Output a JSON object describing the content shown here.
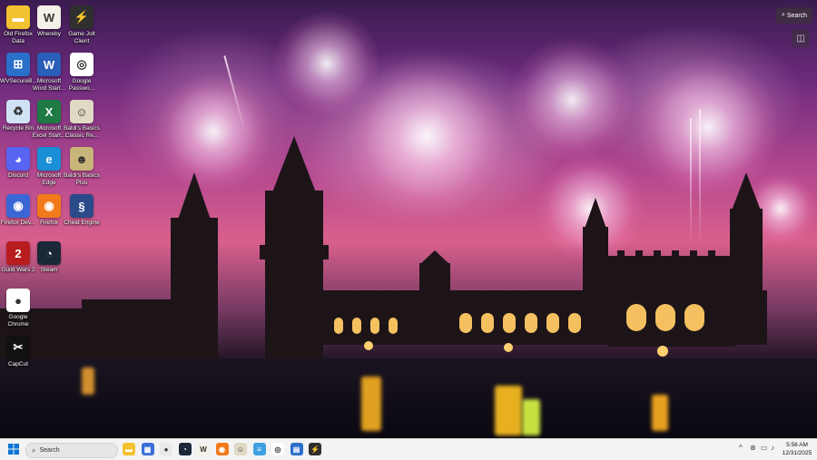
{
  "desktop": {
    "icons": [
      {
        "label": "Old Firefox Data",
        "icon": "folder-icon",
        "color": "#f2c230",
        "glyph": "▬"
      },
      {
        "label": "Whereby",
        "icon": "whereby-icon",
        "color": "#f5f0e8",
        "glyph": "W"
      },
      {
        "label": "Game Jolt Client",
        "icon": "game-jolt-icon",
        "color": "#2f2f2f",
        "glyph": "⚡"
      },
      {
        "label": "WVSecureB...",
        "icon": "wvsecure-icon",
        "color": "#2a6fc9",
        "glyph": "⊞"
      },
      {
        "label": "Microsoft Word Start...",
        "icon": "word-icon",
        "color": "#2b5eb8",
        "glyph": "W"
      },
      {
        "label": "Google Passwo...",
        "icon": "google-passwords-icon",
        "color": "#ffffff",
        "glyph": "◎"
      },
      {
        "label": "Recycle Bin",
        "icon": "recycle-bin-icon",
        "color": "#cfe3f5",
        "glyph": "♻"
      },
      {
        "label": "Microsoft Excel Start...",
        "icon": "excel-icon",
        "color": "#1f7a45",
        "glyph": "X"
      },
      {
        "label": "Baldi's Basics Classic Re...",
        "icon": "baldi-icon",
        "color": "#e0d9c4",
        "glyph": "☺"
      },
      {
        "label": "Discord",
        "icon": "discord-icon",
        "color": "#5865f2",
        "glyph": "◕"
      },
      {
        "label": "Microsoft Edge",
        "icon": "edge-icon",
        "color": "#1a8fd8",
        "glyph": "e"
      },
      {
        "label": "Baldi's Basics Plus",
        "icon": "baldi-plus-icon",
        "color": "#c9b47a",
        "glyph": "☻"
      },
      {
        "label": "Firefox Dev...",
        "icon": "firefox-dev-icon",
        "color": "#3b67d6",
        "glyph": "◉"
      },
      {
        "label": "Firefox",
        "icon": "firefox-icon",
        "color": "#f27a1a",
        "glyph": "◉"
      },
      {
        "label": "Cheat Engine",
        "icon": "cheat-engine-icon",
        "color": "#2a4a8a",
        "glyph": "§"
      },
      {
        "label": "Guild Wars 2",
        "icon": "guild-wars-icon",
        "color": "#b81d1d",
        "glyph": "2"
      },
      {
        "label": "Steam",
        "icon": "steam-icon",
        "color": "#1b2838",
        "glyph": "◔"
      },
      {
        "label": "Google Chrome",
        "icon": "chrome-icon",
        "color": "#ffffff",
        "glyph": "●"
      },
      {
        "label": "CapCut",
        "icon": "capcut-icon",
        "color": "#111111",
        "glyph": "✂"
      }
    ],
    "search_widget": {
      "label": "Search",
      "icon": "search-icon"
    },
    "corner_widget": {
      "icon": "camera-icon",
      "glyph": "◫"
    }
  },
  "taskbar": {
    "start": {
      "icon": "windows-start-icon"
    },
    "search": {
      "placeholder": "Search",
      "icon": "search-icon"
    },
    "pinned": [
      {
        "name": "file-explorer-icon",
        "color": "#f2c230",
        "glyph": "▬"
      },
      {
        "name": "ms-store-icon",
        "color": "#3b6fd8",
        "glyph": "▦"
      },
      {
        "name": "chrome-icon",
        "color": "#e9e9e9",
        "glyph": "●"
      },
      {
        "name": "steam-icon",
        "color": "#1b2838",
        "glyph": "◔"
      },
      {
        "name": "whereby-icon",
        "color": "#f5f0e8",
        "glyph": "W"
      },
      {
        "name": "firefox-icon",
        "color": "#f27a1a",
        "glyph": "◉"
      },
      {
        "name": "baldi-icon",
        "color": "#e0d9c4",
        "glyph": "☺"
      },
      {
        "name": "notepad-icon",
        "color": "#3fa0e0",
        "glyph": "≡"
      },
      {
        "name": "google-passwords-icon",
        "color": "#ffffff",
        "glyph": "◎"
      },
      {
        "name": "app-icon",
        "color": "#2a6fc9",
        "glyph": "▤"
      },
      {
        "name": "game-jolt-icon",
        "color": "#2f2f2f",
        "glyph": "⚡"
      }
    ],
    "tray": {
      "chevron": "^",
      "time": "5:56 AM",
      "date": "12/31/2025"
    }
  }
}
